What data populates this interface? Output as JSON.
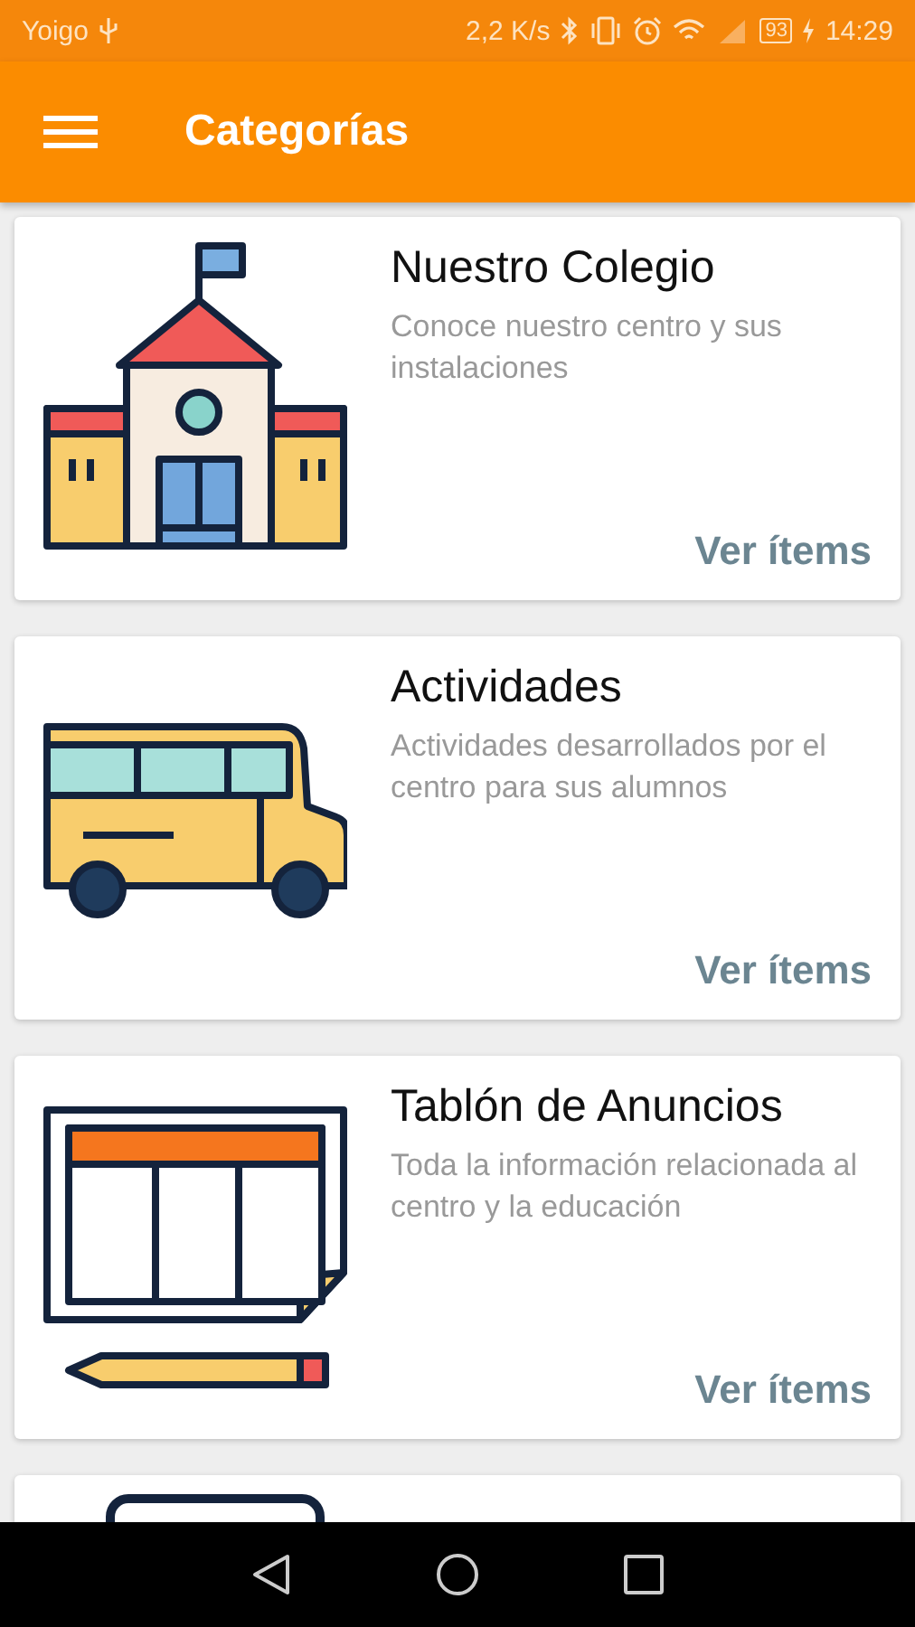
{
  "status_bar": {
    "carrier": "Yoigo",
    "speed": "2,2 K/s",
    "battery": "93",
    "time": "14:29"
  },
  "app_bar": {
    "title": "Categorías"
  },
  "categories": [
    {
      "kind": "school",
      "title": "Nuestro Colegio",
      "description": "Conoce nuestro centro y sus instalaciones",
      "action": "Ver ítems"
    },
    {
      "kind": "bus",
      "title": "Actividades",
      "description": "Actividades desarrollados por el centro para sus alumnos",
      "action": "Ver ítems"
    },
    {
      "kind": "board",
      "title": "Tablón de Anuncios",
      "description": "Toda la información relacionada al centro y la educación",
      "action": "Ver ítems"
    },
    {
      "kind": "partial"
    }
  ]
}
